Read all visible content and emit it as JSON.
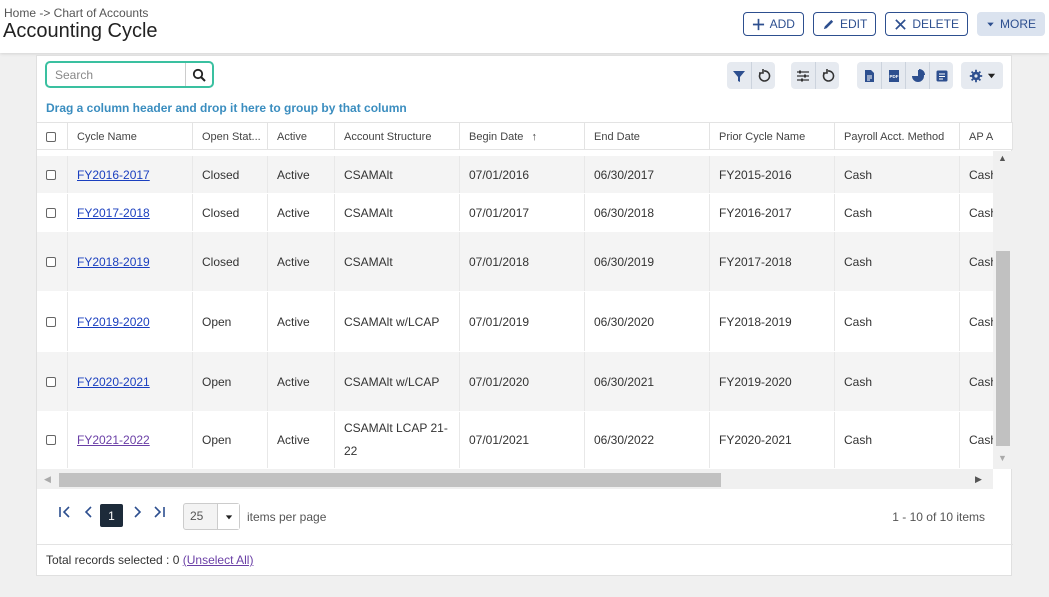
{
  "header": {
    "breadcrumb": "Home -> Chart of Accounts",
    "title": "Accounting Cycle",
    "buttons": {
      "add": "ADD",
      "edit": "EDIT",
      "delete": "DELETE",
      "more": "MORE"
    }
  },
  "search": {
    "placeholder": "Search"
  },
  "group_hint": "Drag a column header and drop it here to group by that column",
  "grid": {
    "columns": {
      "cycle_name": "Cycle Name",
      "open_status": "Open Stat...",
      "active": "Active",
      "account_structure": "Account Structure",
      "begin_date": "Begin Date",
      "sort_indicator": "↑",
      "end_date": "End Date",
      "prior_cycle_name": "Prior Cycle Name",
      "payroll_method": "Payroll Acct. Method",
      "ap_method": "AP A"
    },
    "rows": [
      {
        "cycle_name": "FY2016-2017",
        "open_status": "Closed",
        "active": "Active",
        "account_structure": "CSAMAlt",
        "begin_date": "07/01/2016",
        "end_date": "06/30/2017",
        "prior_cycle_name": "FY2015-2016",
        "payroll_method": "Cash",
        "ap_method": "Cash"
      },
      {
        "cycle_name": "FY2017-2018",
        "open_status": "Closed",
        "active": "Active",
        "account_structure": "CSAMAlt",
        "begin_date": "07/01/2017",
        "end_date": "06/30/2018",
        "prior_cycle_name": "FY2016-2017",
        "payroll_method": "Cash",
        "ap_method": "Cash"
      },
      {
        "cycle_name": "FY2018-2019",
        "open_status": "Closed",
        "active": "Active",
        "account_structure": "CSAMAlt",
        "begin_date": "07/01/2018",
        "end_date": "06/30/2019",
        "prior_cycle_name": "FY2017-2018",
        "payroll_method": "Cash",
        "ap_method": "Cash"
      },
      {
        "cycle_name": "FY2019-2020",
        "open_status": "Open",
        "active": "Active",
        "account_structure": "CSAMAlt w/LCAP",
        "begin_date": "07/01/2019",
        "end_date": "06/30/2020",
        "prior_cycle_name": "FY2018-2019",
        "payroll_method": "Cash",
        "ap_method": "Cash"
      },
      {
        "cycle_name": "FY2020-2021",
        "open_status": "Open",
        "active": "Active",
        "account_structure": "CSAMAlt w/LCAP",
        "begin_date": "07/01/2020",
        "end_date": "06/30/2021",
        "prior_cycle_name": "FY2019-2020",
        "payroll_method": "Cash",
        "ap_method": "Cash"
      },
      {
        "cycle_name": "FY2021-2022",
        "open_status": "Open",
        "active": "Active",
        "account_structure": "CSAMAlt LCAP 21-22",
        "begin_date": "07/01/2021",
        "end_date": "06/30/2022",
        "prior_cycle_name": "FY2020-2021",
        "payroll_method": "Cash",
        "ap_method": "Cash"
      }
    ]
  },
  "pager": {
    "current_page": "1",
    "page_size": "25",
    "items_per_page_label": "items per page",
    "info": "1 - 10 of 10 items"
  },
  "footer": {
    "selected_text": "Total records selected : 0",
    "unselect_link": "(Unselect All)"
  },
  "colors": {
    "accent": "#2d4f8f",
    "search_border": "#3ac0a0",
    "link": "#1a3fbf",
    "group_hint": "#3a8dbf"
  }
}
